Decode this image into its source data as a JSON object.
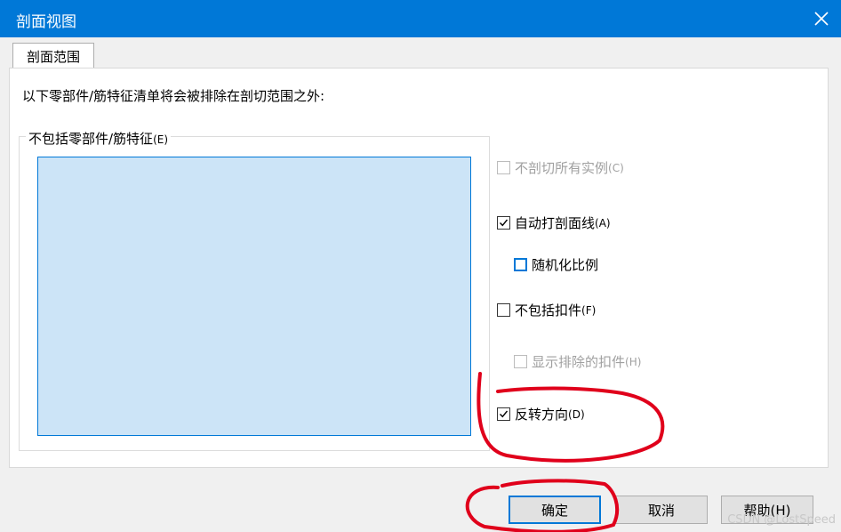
{
  "window": {
    "title": "剖面视图"
  },
  "tabs": [
    {
      "label": "剖面范围"
    }
  ],
  "description": "以下零部件/筋特征清单将会被排除在剖切范围之外:",
  "excludes_group": {
    "label": "不包括零部件/筋特征",
    "accel": "(E)"
  },
  "options": [
    {
      "label": "不剖切所有实例",
      "accel": "(C)",
      "checked": false,
      "enabled": false
    },
    {
      "label": "自动打剖面线",
      "accel": "(A)",
      "checked": true,
      "enabled": true
    },
    {
      "label": "随机化比例",
      "accel": "",
      "checked": false,
      "enabled": true
    },
    {
      "label": "不包括扣件",
      "accel": "(F)",
      "checked": false,
      "enabled": true
    },
    {
      "label": "显示排除的扣件",
      "accel": "(H)",
      "checked": false,
      "enabled": false
    },
    {
      "label": "反转方向",
      "accel": "(D)",
      "checked": true,
      "enabled": true
    }
  ],
  "buttons": {
    "ok": "确定",
    "cancel": "取消",
    "help": "帮助(H)"
  },
  "watermark": "CSDN @LostSpeed",
  "colors": {
    "titlebar": "#0078d7",
    "listbox": "#cce4f7",
    "annotation": "#e0001b"
  }
}
